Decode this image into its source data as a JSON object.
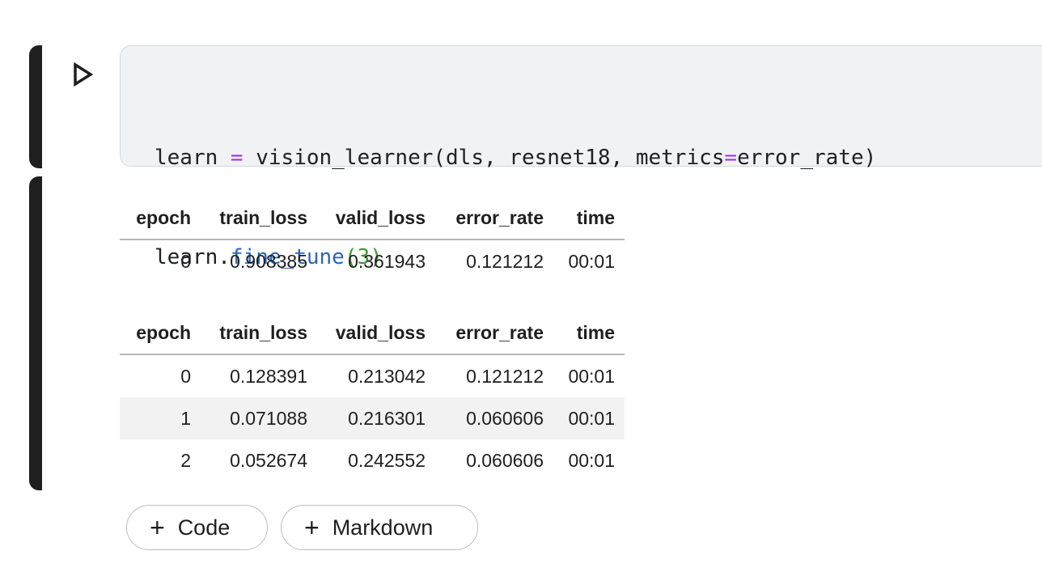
{
  "code_cell": {
    "line1": {
      "a": "learn ",
      "op": "=",
      "b": " vision_learner(dls, resnet18, metrics",
      "op2": "=",
      "c": "error_rate)"
    },
    "line2": {
      "a": "learn.",
      "fn": "fine_tune",
      "p1": "(",
      "num": "3",
      "p2": ")"
    }
  },
  "table_headers": [
    "epoch",
    "train_loss",
    "valid_loss",
    "error_rate",
    "time"
  ],
  "table1": {
    "rows": [
      [
        "0",
        "0.908385",
        "0.361943",
        "0.121212",
        "00:01"
      ]
    ]
  },
  "table2": {
    "rows": [
      [
        "0",
        "0.128391",
        "0.213042",
        "0.121212",
        "00:01"
      ],
      [
        "1",
        "0.071088",
        "0.216301",
        "0.060606",
        "00:01"
      ],
      [
        "2",
        "0.052674",
        "0.242552",
        "0.060606",
        "00:01"
      ]
    ]
  },
  "add_buttons": {
    "code_plus": "+",
    "code_label": "Code",
    "markdown_plus": "+",
    "markdown_label": "Markdown"
  },
  "colors": {
    "operator": "#a333e8",
    "function": "#2a66b8",
    "number": "#3a9b2c"
  }
}
